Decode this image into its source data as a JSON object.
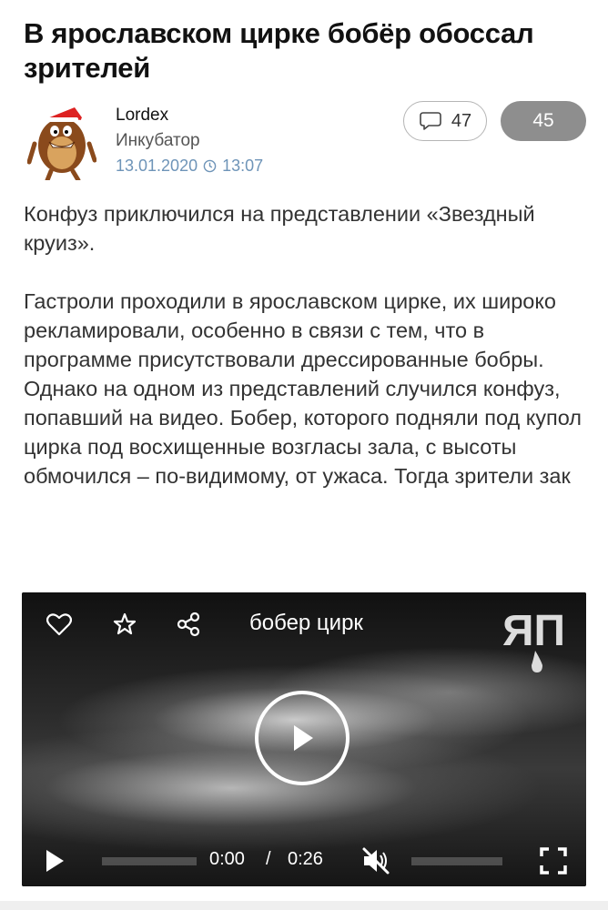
{
  "post": {
    "title": "В ярославском цирке бобёр обоссал зрителей",
    "author": "Lordex",
    "community": "Инкубатор",
    "date": "13.01.2020",
    "time": "13:07",
    "comments_count": "47",
    "rating": "45"
  },
  "story": {
    "paragraph_1": "Конфуз приключился на представлении «Звездный круиз».",
    "paragraph_2": "Гастроли проходили в ярославском цирке, их широко рекламировали, особенно в связи с тем, что в программе присутствовали дрессированные бобры. Однако на одном из представлений случился конфуз, попавший на видео. Бобер, которого подняли под купол цирка под восхищенные возгласы зала, с высоты обмочился – по-видимому, от ужаса. Тогда зрители зак"
  },
  "video": {
    "title": "бобер цирк",
    "current_time": "0:00",
    "separator": "/",
    "duration": "0:26",
    "progress": 0,
    "logo_text": "ЯП"
  },
  "colors": {
    "meta_blue": "#6e94b8",
    "rating_bg": "#8e8e8e"
  },
  "icons": [
    "clock-icon",
    "comment-icon",
    "heart-icon",
    "star-icon",
    "share-icon",
    "play-icon",
    "mute-icon",
    "fullscreen-icon"
  ]
}
